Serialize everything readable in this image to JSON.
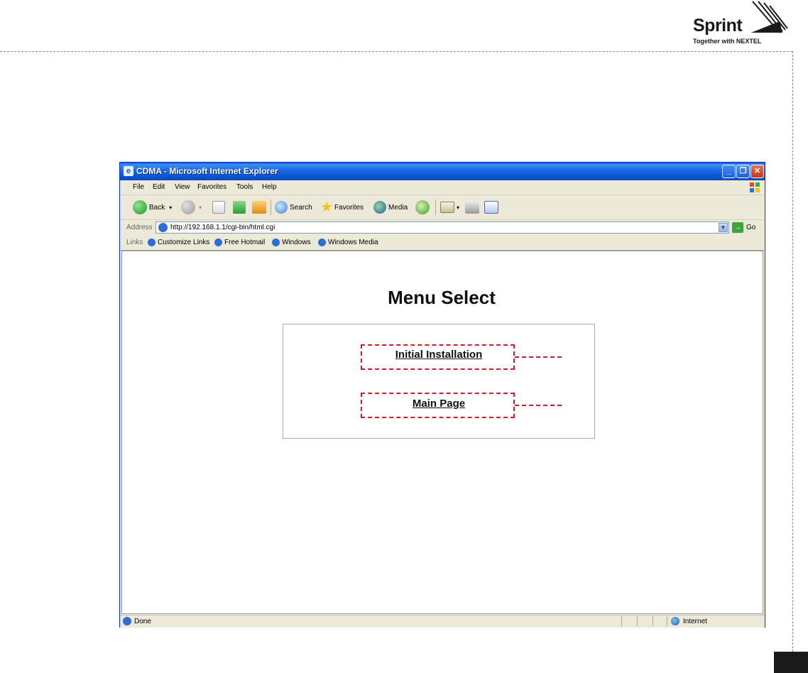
{
  "brand": {
    "name": "Sprint",
    "tagline": "Together with NEXTEL"
  },
  "window": {
    "title": "CDMA - Microsoft Internet Explorer",
    "minimize_glyph": "_",
    "maximize_glyph": "❐",
    "close_glyph": "✕"
  },
  "menubar": {
    "items": [
      "File",
      "Edit",
      "View",
      "Favorites",
      "Tools",
      "Help"
    ]
  },
  "toolbar": {
    "back_label": "Back",
    "search_label": "Search",
    "favorites_label": "Favorites",
    "media_label": "Media"
  },
  "address": {
    "label": "Address",
    "url": "http://192.168.1.1/cgi-bin/html.cgi",
    "go_label": "Go"
  },
  "links": {
    "label": "Links",
    "items": [
      "Customize Links",
      "Free Hotmail",
      "Windows",
      "Windows Media"
    ]
  },
  "page": {
    "title": "Menu Select",
    "links": [
      "Initial Installation",
      "Main Page"
    ]
  },
  "status": {
    "text": "Done",
    "zone": "Internet"
  },
  "colors": {
    "titlebar": "#0a54d0",
    "highlight": "#c8202a",
    "chrome": "#ece9d8"
  }
}
